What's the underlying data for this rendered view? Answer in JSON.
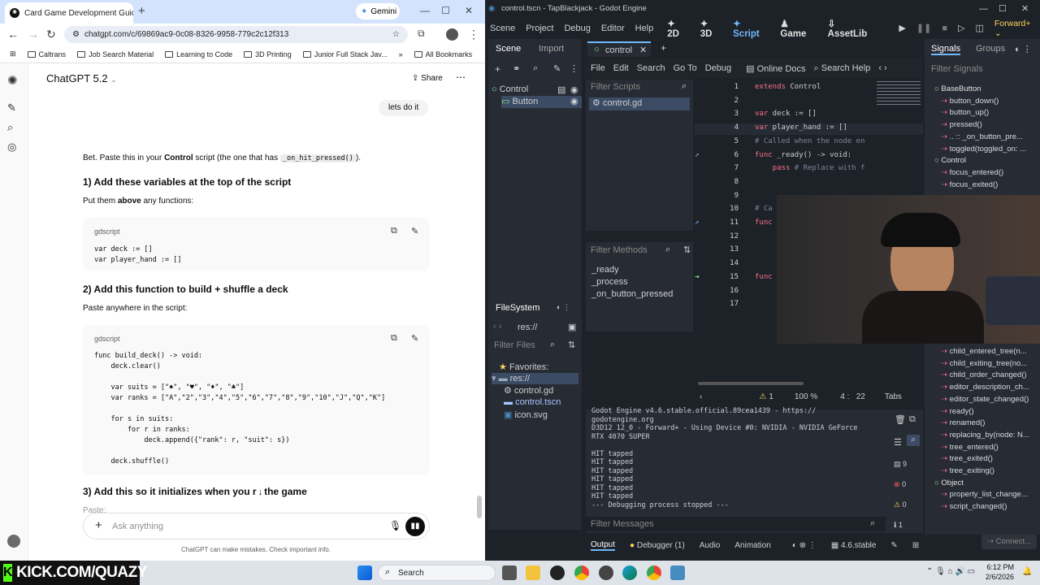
{
  "chrome": {
    "tab_title": "Card Game Development Guid",
    "gemini": "Gemini",
    "url": "chatgpt.com/c/69869ac9-0c08-8326-9958-779c2c12f313",
    "bookmarks": [
      "Caltrans",
      "Job Search Material",
      "Learning to Code",
      "3D Printing",
      "Junior Full Stack Jav..."
    ],
    "all_bookmarks": "All Bookmarks"
  },
  "gpt": {
    "model": "ChatGPT 5.2",
    "share": "Share",
    "user_msg": "lets do it",
    "intro_a": "Bet. Paste this in your ",
    "intro_b": "Control",
    "intro_c": " script (the one that has ",
    "intro_code": "_on_hit_pressed()",
    "intro_d": ").",
    "h1": "1) Add these variables at the top of the script",
    "p1a": "Put them ",
    "p1b": "above",
    "p1c": " any functions:",
    "lang": "gdscript",
    "code1": "var deck := []\nvar player_hand := []",
    "h2": "2) Add this function to build + shuffle a deck",
    "p2": "Paste anywhere in the script:",
    "code2": "func build_deck() -> void:\n    deck.clear()\n\n    var suits = [\"♠\", \"♥\", \"♦\", \"♣\"]\n    var ranks = [\"A\",\"2\",\"3\",\"4\",\"5\",\"6\",\"7\",\"8\",\"9\",\"10\",\"J\",\"Q\",\"K\"]\n\n    for s in suits:\n        for r in ranks:\n            deck.append({\"rank\": r, \"suit\": s})\n\n    deck.shuffle()",
    "h3": "3) Add this so it initializes when you r",
    "h3b": "the game",
    "p3": "Paste:",
    "ask_placeholder": "Ask anything",
    "disclaimer": "ChatGPT can make mistakes. Check important info."
  },
  "godot": {
    "title": "control.tscn - TapBlackjack - Godot Engine",
    "menu": [
      "Scene",
      "Project",
      "Debug",
      "Editor",
      "Help"
    ],
    "workspaces": [
      "2D",
      "3D",
      "Script",
      "Game",
      "AssetLib"
    ],
    "renderer": "Forward+",
    "scene_tab": "Scene",
    "import_tab": "Import",
    "tree_control": "Control",
    "tree_button": "Button",
    "editor_tab": "control",
    "script_menu": [
      "File",
      "Edit",
      "Search",
      "Go To",
      "Debug"
    ],
    "online_docs": "Online Docs",
    "search_help": "Search Help",
    "filter_scripts": "Filter Scripts",
    "script_file": "control.gd",
    "filter_methods": "Filter Methods",
    "methods": [
      "_ready",
      "_process",
      "_on_button_pressed"
    ],
    "code_lines": [
      {
        "n": "1",
        "t": "extends Control"
      },
      {
        "n": "2",
        "t": ""
      },
      {
        "n": "3",
        "t": "var deck := []"
      },
      {
        "n": "4",
        "t": "var player_hand := []"
      },
      {
        "n": "5",
        "t": "# Called when the node en"
      },
      {
        "n": "6",
        "t": "func _ready() -> void:"
      },
      {
        "n": "7",
        "t": "    pass # Replace with f"
      },
      {
        "n": "8",
        "t": ""
      },
      {
        "n": "9",
        "t": ""
      },
      {
        "n": "10",
        "t": "# Ca"
      },
      {
        "n": "11",
        "t": "func"
      },
      {
        "n": "12",
        "t": ""
      },
      {
        "n": "13",
        "t": ""
      },
      {
        "n": "14",
        "t": ""
      },
      {
        "n": "15",
        "t": "func"
      },
      {
        "n": "16",
        "t": ""
      },
      {
        "n": "17",
        "t": ""
      }
    ],
    "status_warn": "1",
    "zoom": "100 %",
    "cursor": "4 :   22",
    "tabs": "Tabs",
    "filesystem": "FileSystem",
    "res_path": "res://",
    "filter_files": "Filter Files",
    "favorites": "Favorites:",
    "res_root": "res://",
    "files": [
      "control.gd",
      "control.tscn",
      "icon.svg"
    ],
    "output_lines": [
      "Godot Engine v4.6.stable.official.89cea1439 - https://",
      "godotengine.org",
      "D3D12 12_0 - Forward+ - Using Device #0: NVIDIA - NVIDIA GeForce",
      "RTX 4070 SUPER",
      "",
      "HIT tapped",
      "HIT tapped",
      "HIT tapped",
      "HIT tapped",
      "HIT tapped",
      "HIT tapped",
      "--- Debugging process stopped ---"
    ],
    "filter_messages": "Filter Messages",
    "counts": [
      "9",
      "0",
      "0",
      "1"
    ],
    "bottom_tabs": [
      "Output",
      "Debugger (1)",
      "Audio",
      "Animation"
    ],
    "version": "4.6.stable",
    "signals_tab": "Signals",
    "groups_tab": "Groups",
    "filter_signals": "Filter Signals",
    "signals_top": [
      {
        "t": "BaseButton",
        "h": true
      },
      {
        "t": "button_down()",
        "h": false
      },
      {
        "t": "button_up()",
        "h": false
      },
      {
        "t": "pressed()",
        "h": false
      },
      {
        "t": ".. :: _on_button_pre...",
        "h": false
      },
      {
        "t": "toggled(toggled_on: ...",
        "h": false
      },
      {
        "t": "Control",
        "h": true
      },
      {
        "t": "focus_entered()",
        "h": false
      },
      {
        "t": "focus_exited()",
        "h": false
      }
    ],
    "signals_bottom": [
      {
        "t": "child_entered_tree(n...",
        "h": false
      },
      {
        "t": "child_exiting_tree(no...",
        "h": false
      },
      {
        "t": "child_order_changed()",
        "h": false
      },
      {
        "t": "editor_description_ch...",
        "h": false
      },
      {
        "t": "editor_state_changed()",
        "h": false
      },
      {
        "t": "ready()",
        "h": false
      },
      {
        "t": "renamed()",
        "h": false
      },
      {
        "t": "replacing_by(node: N...",
        "h": false
      },
      {
        "t": "tree_entered()",
        "h": false
      },
      {
        "t": "tree_exited()",
        "h": false
      },
      {
        "t": "tree_exiting()",
        "h": false
      },
      {
        "t": "Object",
        "h": true
      },
      {
        "t": "property_list_change...",
        "h": false
      },
      {
        "t": "script_changed()",
        "h": false
      }
    ],
    "connect": "Connect..."
  },
  "taskbar": {
    "kick": "KICK.COM/QUAZY",
    "search": "Search",
    "time": "6:12 PM",
    "date": "2/6/2026"
  }
}
